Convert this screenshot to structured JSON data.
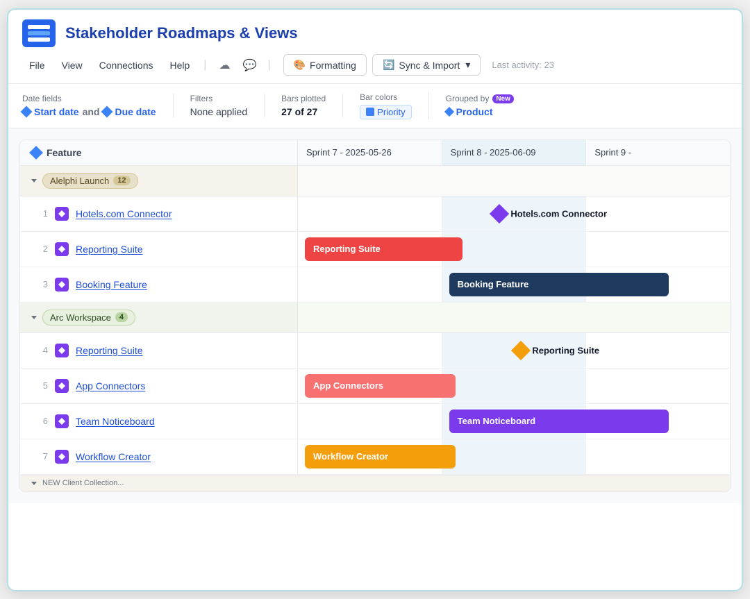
{
  "app": {
    "title": "Stakeholder Roadmaps & Views",
    "logo_alt": "App Logo"
  },
  "nav": {
    "items": [
      "File",
      "View",
      "Connections",
      "Help"
    ],
    "separator": "|"
  },
  "toolbar_buttons": {
    "formatting": "Formatting",
    "sync_import": "Sync & Import",
    "last_activity": "Last activity: 23"
  },
  "filters_bar": {
    "date_fields_label": "Date fields",
    "start_date": "Start date",
    "and": "and",
    "due_date": "Due date",
    "filters_label": "Filters",
    "filters_value": "None applied",
    "bars_plotted_label": "Bars plotted",
    "bars_plotted_value": "27 of 27",
    "bar_colors_label": "Bar colors",
    "bar_colors_value": "Priority",
    "grouped_by_label": "Grouped by",
    "grouped_by_new": "New",
    "grouped_by_value": "Product"
  },
  "gantt": {
    "column_header": "Feature",
    "sprint_headers": [
      "Sprint 7 - 2025-05-26",
      "Sprint 8 - 2025-06-09",
      "Sprint 9 -"
    ],
    "groups": [
      {
        "name": "Alelphi Launch",
        "count": 12,
        "rows": [
          {
            "num": 1,
            "name": "Hotels.com Connector",
            "bar": {
              "type": "diamond",
              "color": "purple",
              "col": 1,
              "label": "Hotels.com Connector",
              "offset": "50%"
            }
          },
          {
            "num": 2,
            "name": "Reporting Suite",
            "bar": {
              "type": "bar",
              "color": "red",
              "col_start": 0,
              "col_end": 1,
              "label": "Reporting Suite"
            }
          },
          {
            "num": 3,
            "name": "Booking Feature",
            "bar": {
              "type": "bar",
              "color": "navy",
              "col_start": 1,
              "col_end": 2,
              "label": "Booking Feature"
            }
          }
        ]
      },
      {
        "name": "Arc Workspace",
        "count": 4,
        "rows": [
          {
            "num": 4,
            "name": "Reporting Suite",
            "bar": {
              "type": "diamond",
              "color": "orange",
              "col": 1,
              "label": "Reporting Suite",
              "offset": "60%"
            }
          },
          {
            "num": 5,
            "name": "App Connectors",
            "bar": {
              "type": "bar",
              "color": "salmon",
              "col_start": 0,
              "col_end": 1,
              "label": "App Connectors"
            }
          },
          {
            "num": 6,
            "name": "Team Noticeboard",
            "bar": {
              "type": "bar",
              "color": "purple",
              "col_start": 1,
              "col_end": 2,
              "label": "Team Noticeboard"
            }
          },
          {
            "num": 7,
            "name": "Workflow Creator",
            "bar": {
              "type": "bar",
              "color": "orange",
              "col_start": 0,
              "col_end": 1,
              "label": "Workflow Creator"
            }
          }
        ]
      }
    ]
  }
}
